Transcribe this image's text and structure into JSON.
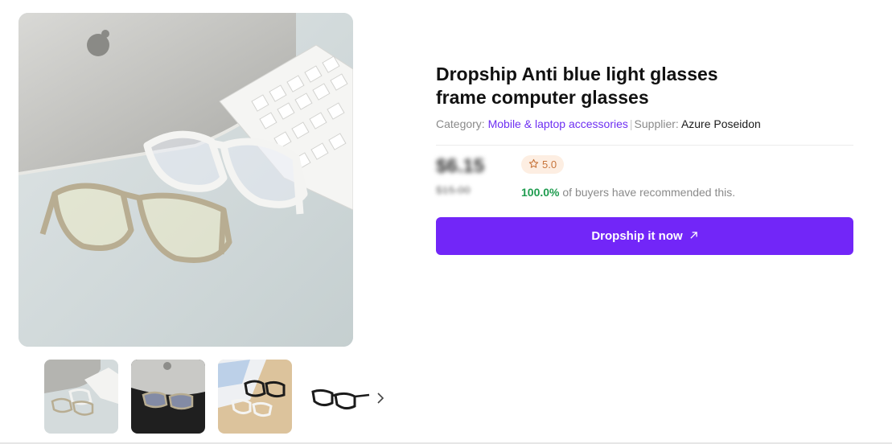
{
  "product": {
    "title_line1": "Dropship Anti blue light glasses",
    "title_line2": "frame computer glasses",
    "category_label": "Category:",
    "category_value": "Mobile & laptop accessories",
    "separator": "|",
    "supplier_label": "Supplier:",
    "supplier_value": "Azure Poseidon",
    "price": "$6.15",
    "original_price": "$15.00",
    "rating": "5.0",
    "recommend_percent": "100.0%",
    "recommend_text": " of buyers have recommended this.",
    "cta_label": "Dropship it now"
  },
  "icons": {
    "rating": "star-outline-icon",
    "cta": "arrow-up-right-icon",
    "thumb_nav": "chevron-right-icon"
  },
  "colors": {
    "accent": "#7226f8",
    "link": "#6e2ff2",
    "success": "#1f9c4f",
    "rating_bg": "#fdeee2",
    "rating_fg": "#c8743a"
  }
}
